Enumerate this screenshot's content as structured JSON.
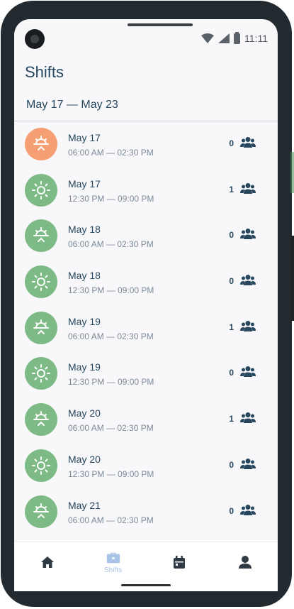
{
  "status_bar": {
    "time": "11:11"
  },
  "header": {
    "title": "Shifts"
  },
  "week_range": "May 17 — May 23",
  "shifts": [
    {
      "date": "May 17",
      "time": "06:00 AM — 02:30 PM",
      "count": "0",
      "kind": "sunrise",
      "color": "#f79f74"
    },
    {
      "date": "May 17",
      "time": "12:30 PM — 09:00 PM",
      "count": "1",
      "kind": "sun",
      "color": "#7dba85"
    },
    {
      "date": "May 18",
      "time": "06:00 AM — 02:30 PM",
      "count": "0",
      "kind": "sunrise",
      "color": "#7dba85"
    },
    {
      "date": "May 18",
      "time": "12:30 PM — 09:00 PM",
      "count": "0",
      "kind": "sun",
      "color": "#7dba85"
    },
    {
      "date": "May 19",
      "time": "06:00 AM — 02:30 PM",
      "count": "1",
      "kind": "sunrise",
      "color": "#7dba85"
    },
    {
      "date": "May 19",
      "time": "12:30 PM — 09:00 PM",
      "count": "0",
      "kind": "sun",
      "color": "#7dba85"
    },
    {
      "date": "May 20",
      "time": "06:00 AM — 02:30 PM",
      "count": "1",
      "kind": "sunrise",
      "color": "#7dba85"
    },
    {
      "date": "May 20",
      "time": "12:30 PM — 09:00 PM",
      "count": "0",
      "kind": "sun",
      "color": "#7dba85"
    },
    {
      "date": "May 21",
      "time": "06:00 AM — 02:30 PM",
      "count": "0",
      "kind": "sunrise",
      "color": "#7dba85"
    }
  ],
  "bottom_nav": [
    {
      "label": "",
      "icon": "home-icon",
      "active": false
    },
    {
      "label": "Shifts",
      "icon": "briefcase-icon",
      "active": true
    },
    {
      "label": "",
      "icon": "calendar-icon",
      "active": false
    },
    {
      "label": "",
      "icon": "person-icon",
      "active": false
    }
  ],
  "colors": {
    "accent": "#27475f",
    "green": "#7dba85",
    "orange": "#f79f74",
    "active_tab": "#a8c3e8"
  }
}
